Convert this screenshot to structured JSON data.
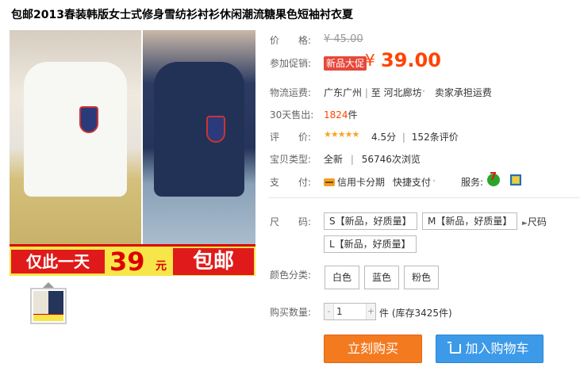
{
  "product": {
    "title": "包邮2013春装韩版女士式修身雪纺衫衬衫休闲潮流糖果色短袖衬衣夏"
  },
  "image": {
    "banner_left": "仅此一天",
    "banner_price": "39",
    "banner_unit": "元",
    "banner_right": "包邮"
  },
  "price": {
    "label": "价　　格:",
    "original": "¥ 45.00",
    "promo_label": "参加促销:",
    "promo_tag": "新品大促",
    "currency": "¥",
    "value": "39.00"
  },
  "shipping": {
    "label": "物流运费:",
    "from": "广东广州",
    "sep": "|",
    "to_label": "至",
    "to": "河北廊坊",
    "fee": "卖家承担运费"
  },
  "sales": {
    "label": "30天售出:",
    "count": "1824",
    "unit": "件"
  },
  "rating": {
    "label": "评　　价:",
    "stars": "★★★★★",
    "score": "4.5分",
    "sep": "|",
    "reviews": "152条评价",
    "score_value": 4.5
  },
  "baby_type": {
    "label": "宝贝类型:",
    "condition": "全新",
    "sep": "|",
    "views": "56746次浏览"
  },
  "payment": {
    "label": "支　　付:",
    "card": "信用卡分期",
    "quick": "快捷支付",
    "service_label": "服务:"
  },
  "size": {
    "label": "尺　　码:",
    "options": [
      "S【新品，好质量】",
      "M【新品，好质量】",
      "L【新品，好质量】"
    ],
    "chart_link": "尺码"
  },
  "color": {
    "label": "颜色分类:",
    "options": [
      "白色",
      "蓝色",
      "粉色"
    ]
  },
  "quantity": {
    "label": "购买数量:",
    "value": "1",
    "minus": "-",
    "plus": "+",
    "stock": "件 (库存3425件)"
  },
  "actions": {
    "buy_now": "立刻购买",
    "add_cart": "加入购物车"
  },
  "colors": {
    "price": "#ff4400",
    "buy_button": "#f47a20",
    "cart_button": "#3c9ae8",
    "promo_tag": "#e6483b"
  }
}
